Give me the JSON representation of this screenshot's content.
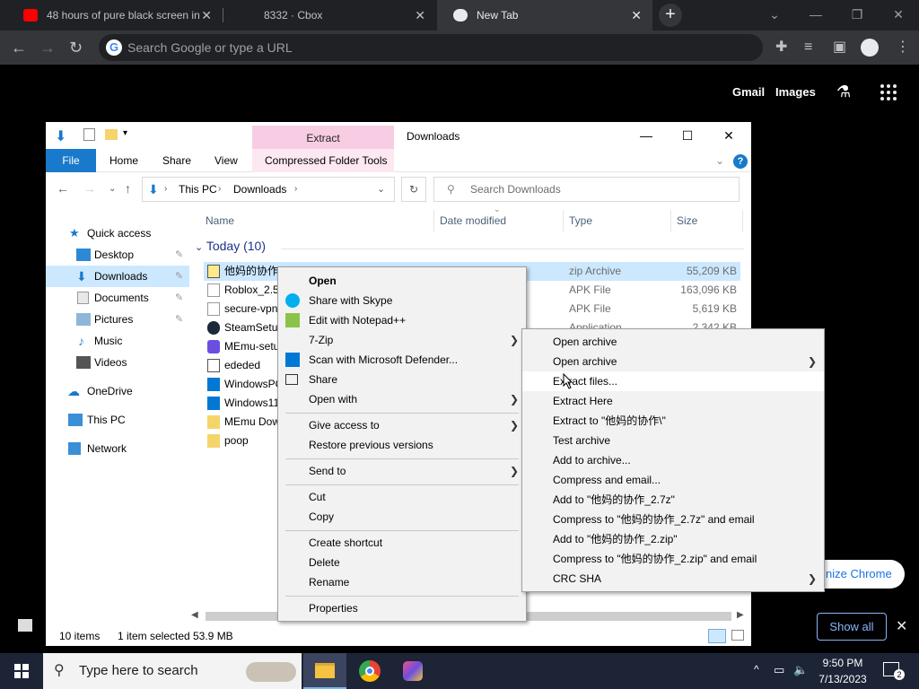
{
  "browser": {
    "tabs": [
      {
        "label": "48 hours of pure black screen in",
        "favicon": "youtube-icon"
      },
      {
        "label": "8332 · Cbox",
        "favicon": "cbox-icon"
      },
      {
        "label": "New Tab",
        "favicon": "chrome-icon"
      }
    ],
    "new_tab_symbol": "+",
    "omnibox_placeholder": "Search Google or type a URL",
    "top_links": [
      "Gmail",
      "Images"
    ],
    "customize_label": "nize Chrome",
    "download_shelf": {
      "show_all": "Show all",
      "close": "✕"
    }
  },
  "explorer": {
    "title": "Downloads",
    "context_tab": "Extract",
    "ribbon_tabs": [
      "File",
      "Home",
      "Share",
      "View",
      "Compressed Folder Tools"
    ],
    "breadcrumb": [
      "This PC",
      "Downloads"
    ],
    "search_placeholder": "Search Downloads",
    "nav": {
      "quick_access": "Quick access",
      "items": [
        "Desktop",
        "Downloads",
        "Documents",
        "Pictures",
        "Music",
        "Videos"
      ],
      "onedrive": "OneDrive",
      "this_pc": "This PC",
      "network": "Network"
    },
    "columns": {
      "name": "Name",
      "date": "Date modified",
      "type": "Type",
      "size": "Size"
    },
    "group_label": "Today (10)",
    "files": [
      {
        "name": "他妈的协作",
        "type": "zip Archive",
        "size": "55,209 KB"
      },
      {
        "name": "Roblox_2.5",
        "type": "APK File",
        "size": "163,096 KB"
      },
      {
        "name": "secure-vpn",
        "type": "APK File",
        "size": "5,619 KB"
      },
      {
        "name": "SteamSetup",
        "type": "Application",
        "size": "2,342 KB"
      },
      {
        "name": "MEmu-setu",
        "type": "",
        "size": ""
      },
      {
        "name": "ededed",
        "type": "",
        "size": ""
      },
      {
        "name": "WindowsPC",
        "type": "",
        "size": ""
      },
      {
        "name": "Windows11",
        "type": "",
        "size": ""
      },
      {
        "name": "MEmu Dow",
        "type": "",
        "size": ""
      },
      {
        "name": "poop",
        "type": "",
        "size": ""
      }
    ],
    "status": {
      "count": "10 items",
      "selected": "1 item selected",
      "size": "53.9 MB"
    }
  },
  "context_menu": {
    "open": "Open",
    "share_skype": "Share with Skype",
    "edit_notepad": "Edit with Notepad++",
    "sevenzip": "7-Zip",
    "defender": "Scan with Microsoft Defender...",
    "share": "Share",
    "open_with": "Open with",
    "give_access": "Give access to",
    "restore": "Restore previous versions",
    "send_to": "Send to",
    "cut": "Cut",
    "copy": "Copy",
    "create_shortcut": "Create shortcut",
    "delete": "Delete",
    "rename": "Rename",
    "properties": "Properties"
  },
  "submenu": [
    "Open archive",
    "Open archive",
    "Extract files...",
    "Extract Here",
    "Extract to \"他妈的协作\\\"",
    "Test archive",
    "Add to archive...",
    "Compress and email...",
    "Add to \"他妈的协作_2.7z\"",
    "Compress to \"他妈的协作_2.7z\" and email",
    "Add to \"他妈的协作_2.zip\"",
    "Compress to \"他妈的协作_2.zip\" and email",
    "CRC SHA"
  ],
  "taskbar": {
    "search_placeholder": "Type here to search",
    "time": "9:50 PM",
    "date": "7/13/2023",
    "notification_count": "2"
  }
}
